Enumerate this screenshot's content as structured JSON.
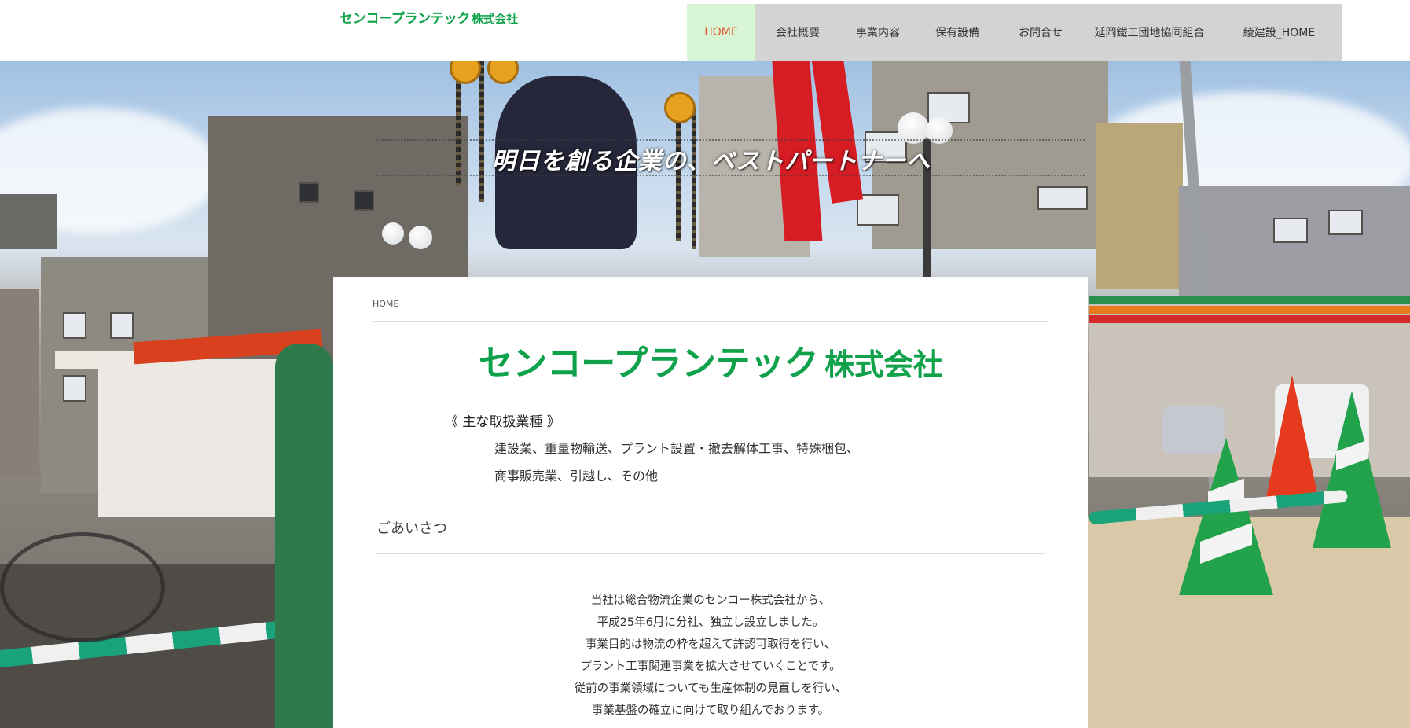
{
  "header": {
    "logo_name": "センコープランテック",
    "logo_suffix": "株式会社",
    "nav": [
      {
        "label": "HOME",
        "active": true
      },
      {
        "label": "会社概要",
        "active": false
      },
      {
        "label": "事業内容",
        "active": false
      },
      {
        "label": "保有設備",
        "active": false
      },
      {
        "label": "お問合せ",
        "active": false
      },
      {
        "label": "延岡鐵工団地協同組合",
        "active": false
      },
      {
        "label": "綾建設_HOME",
        "active": false
      }
    ]
  },
  "hero": {
    "slogan": "明日を創る企業の、ベストパートナーへ"
  },
  "content": {
    "breadcrumb": "HOME",
    "logo_name": "センコープランテック",
    "logo_suffix": "株式会社",
    "business_heading": "《 主な取扱業種 》",
    "business_lines": [
      "建設業、重量物輸送、プラント設置・撤去解体工事、特殊梱包、",
      "商事販売業、引越し、その他"
    ],
    "greeting_title": "ごあいさつ",
    "greeting_lines": [
      "当社は総合物流企業のセンコー株式会社から、",
      "平成25年6月に分社、独立し設立しました。",
      "事業目的は物流の枠を超えて許認可取得を行い、",
      "プラント工事関連事業を拡大させていくことです。",
      "従前の事業領域についても生産体制の見直しを行い、",
      "事業基盤の確立に向けて取り組んでおります。"
    ]
  },
  "colors": {
    "brand_green": "#0fa24a",
    "nav_background": "#d3d3d3",
    "nav_active_background": "#d8f6d6",
    "nav_active_text": "#e35a2c"
  }
}
